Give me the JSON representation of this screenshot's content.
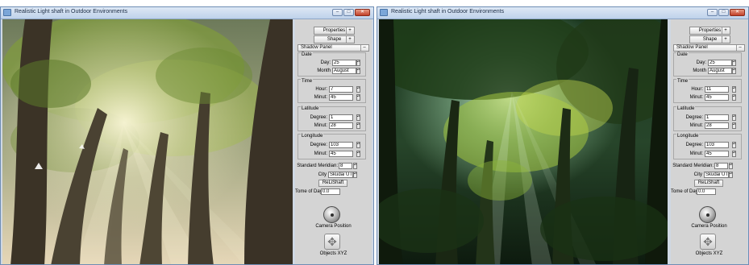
{
  "windows": [
    {
      "title": "Realistic Light shaft in Outdoor Environments",
      "panel": {
        "properties_label": "Properties",
        "shape_label": "Shape",
        "plus": "+",
        "shadow_panel_label": "Shadow Panel",
        "minus": "–",
        "date": {
          "title": "Date",
          "day_label": "Day:",
          "day_value": "25",
          "month_label": "Month",
          "month_value": "August"
        },
        "time": {
          "title": "Time",
          "hour_label": "Hour:",
          "hour_value": "7",
          "minut_label": "Minut:",
          "minut_value": "45"
        },
        "latitude": {
          "title": "Latitude",
          "degree_label": "Degree:",
          "degree_value": "1",
          "minut_label": "Minut:",
          "minut_value": "28"
        },
        "longitude": {
          "title": "Longitude",
          "degree_label": "Degree:",
          "degree_value": "103",
          "minut_label": "Minut:",
          "minut_value": "45"
        },
        "standard_meridian_label": "Standard Meridian:",
        "standard_meridian_value": "8",
        "city_label": "City",
        "city_value": "Skudai UTM",
        "relishaft_label": "ReLiShaft",
        "time_of_day_label": "Tome of Day:",
        "time_of_day_value": "0.0",
        "camera_position_label": "Camera Position",
        "objects_xyz_label": "Objects XYZ"
      }
    },
    {
      "title": "Realistic Light shaft in Outdoor Environments",
      "panel": {
        "properties_label": "Properties",
        "shape_label": "Shape",
        "plus": "+",
        "shadow_panel_label": "Shadow Panel",
        "minus": "–",
        "date": {
          "title": "Date",
          "day_label": "Day:",
          "day_value": "25",
          "month_label": "Month",
          "month_value": "August"
        },
        "time": {
          "title": "Time",
          "hour_label": "Hour:",
          "hour_value": "11",
          "minut_label": "Minut:",
          "minut_value": "45"
        },
        "latitude": {
          "title": "Latitude",
          "degree_label": "Degree:",
          "degree_value": "1",
          "minut_label": "Minut:",
          "minut_value": "28"
        },
        "longitude": {
          "title": "Longitude",
          "degree_label": "Degree:",
          "degree_value": "103",
          "minut_label": "Minut:",
          "minut_value": "45"
        },
        "standard_meridian_label": "Standard Meridian:",
        "standard_meridian_value": "8",
        "city_label": "City",
        "city_value": "Skudai UTM",
        "relishaft_label": "ReLiShaft",
        "time_of_day_label": "Tome of Day:",
        "time_of_day_value": "0.0",
        "camera_position_label": "Camera Position",
        "objects_xyz_label": "Objects XYZ"
      }
    }
  ],
  "window_controls": {
    "minimize": "–",
    "maximize": "□",
    "close": "✕"
  },
  "spinner_glyph": "▴▾",
  "icons": {
    "camera": "camera-position-icon",
    "objects": "objects-xyz-icon",
    "app": "app-icon"
  },
  "colors": {
    "title_bar": "#c9d9ee",
    "close_button": "#c84a34",
    "panel_bg": "#d4d4d4",
    "forest_dark_left": "#3a3225",
    "forest_dark_right": "#0f1d10",
    "foliage": "#8db23e",
    "light_shaft": "#f4f0cc"
  }
}
